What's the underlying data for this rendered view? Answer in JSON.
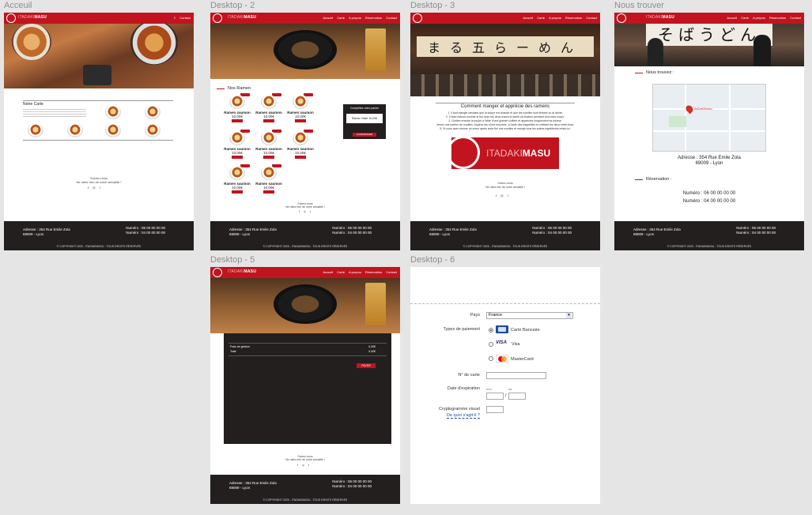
{
  "frames": {
    "accueil": {
      "label": "Acceuil"
    },
    "d2": {
      "label": "Desktop - 2"
    },
    "d3": {
      "label": "Desktop - 3"
    },
    "trouver": {
      "label": "Nous trouver"
    },
    "d5": {
      "label": "Desktop - 5"
    },
    "d6": {
      "label": "Desktop - 6"
    }
  },
  "brand": {
    "prefix": "ITADAKI",
    "name": "MASU"
  },
  "nav": {
    "accueil": "Accueil",
    "carte": "Carte",
    "apropos": "A propos",
    "reservation": "Réservation",
    "contact": "Contact"
  },
  "nav_short": {
    "contact": "Contact"
  },
  "footer": {
    "addr1": "Adresse : 354 Rue Emile Zola",
    "addr2": "69009 - Lyon",
    "num1": "Numéro : 06 00 00 00 00",
    "num2": "Numéro : 04 00 00 00 00",
    "copy": "© COPYRIGHT 2020 - ITADAKIMASU - TOUS DROITS RÉSERVÉS"
  },
  "social": {
    "facebook": "f",
    "instagram": "◎",
    "twitter": "t"
  },
  "accueil": {
    "carte_title": "Notre Carte",
    "suivez1": "Suivez-nous",
    "suivez2": "Ne ratez rien de notre actualité !"
  },
  "d2": {
    "section": "Nos Ramen",
    "ramen": [
      {
        "name": "Ramen saumon",
        "price": "10.00€"
      },
      {
        "name": "Ramen saumon",
        "price": "10.00€"
      },
      {
        "name": "Ramen saumon",
        "price": "10.00€"
      },
      {
        "name": "Ramen saumon",
        "price": "10.00€"
      },
      {
        "name": "Ramen saumon",
        "price": "10.00€"
      },
      {
        "name": "Ramen saumon",
        "price": "10.00€"
      },
      {
        "name": "Ramen saumon",
        "price": "10.00€"
      },
      {
        "name": "Ramen saumon",
        "price": "10.00€"
      }
    ],
    "panier_title": "Complétez votre panier",
    "panier_item": "Ramen Saké 10,00€",
    "commander": "COMMANDER",
    "suivez1": "Suivez-nous",
    "suivez2": "Ne ratez rien de notre actualité !"
  },
  "d3": {
    "banner": "まる五らーめん",
    "title": "Comment manger et apprécie des ramens",
    "steps": [
      "1. Il faut manger pendant que la soupe est chaude et que les nouilles sont fermes ou al dente.",
      "2. Il faut d'abord toucher le bol avec les deux mains et sentir sa chaleur pendant tout votre corps.",
      "3. Goûtez ensuite la soupe à l'aide d'une grande cuillère et appréciez longuement sa saveur.",
      "Venez une portion de nouilles. Aspirez-les d'une bouchée, à l'aide des baguettes en mettant les deux entre-bras.",
      "5. Si vous avez encore un creux après avoir fini vos nouilles et mangé tous les autres ingrédients rendu ici."
    ],
    "logo_prefix": "ITADAKI",
    "logo_name": "MASU",
    "suivez1": "Suivez-nous",
    "suivez2": "Ne ratez rien de notre actualité !"
  },
  "trouver": {
    "banner": "そばうどん",
    "find": "Nous trouvez :",
    "map_pin": "ItaDaKiMasu",
    "addr1": "Adresse : 354 Rue Emile Zola",
    "addr2": "69009 - Lyon",
    "resa": "Réservation :",
    "num1": "Numéro : 06 00 00 00 00",
    "num2": "Numéro : 04 00 00 00 00"
  },
  "d5": {
    "frais": "Frais de gestion",
    "frais_val": "0,00€",
    "total": "Total",
    "total_val": "0,00€",
    "payer": "PAYER",
    "suivez1": "Suivez-nous",
    "suivez2": "Ne ratez rien de notre actualité !"
  },
  "d6": {
    "pays_label": "Pays",
    "pays_value": "France",
    "types_label": "Types de paiement",
    "cb": "Carte Bancaire",
    "visa": "Visa",
    "mc": "MasterCard",
    "visa_logo": "VISA",
    "numcarte": "N° de carte",
    "date": "Date d'expiration",
    "mm": "mm",
    "aa": "aa",
    "sep": "/",
    "crypto": "Cryptogramme visuel",
    "help": "De quoi s'agit-il ?"
  },
  "colors": {
    "red": "#c1141f",
    "dark": "#231f1f",
    "canvas": "#e5e5e5"
  }
}
